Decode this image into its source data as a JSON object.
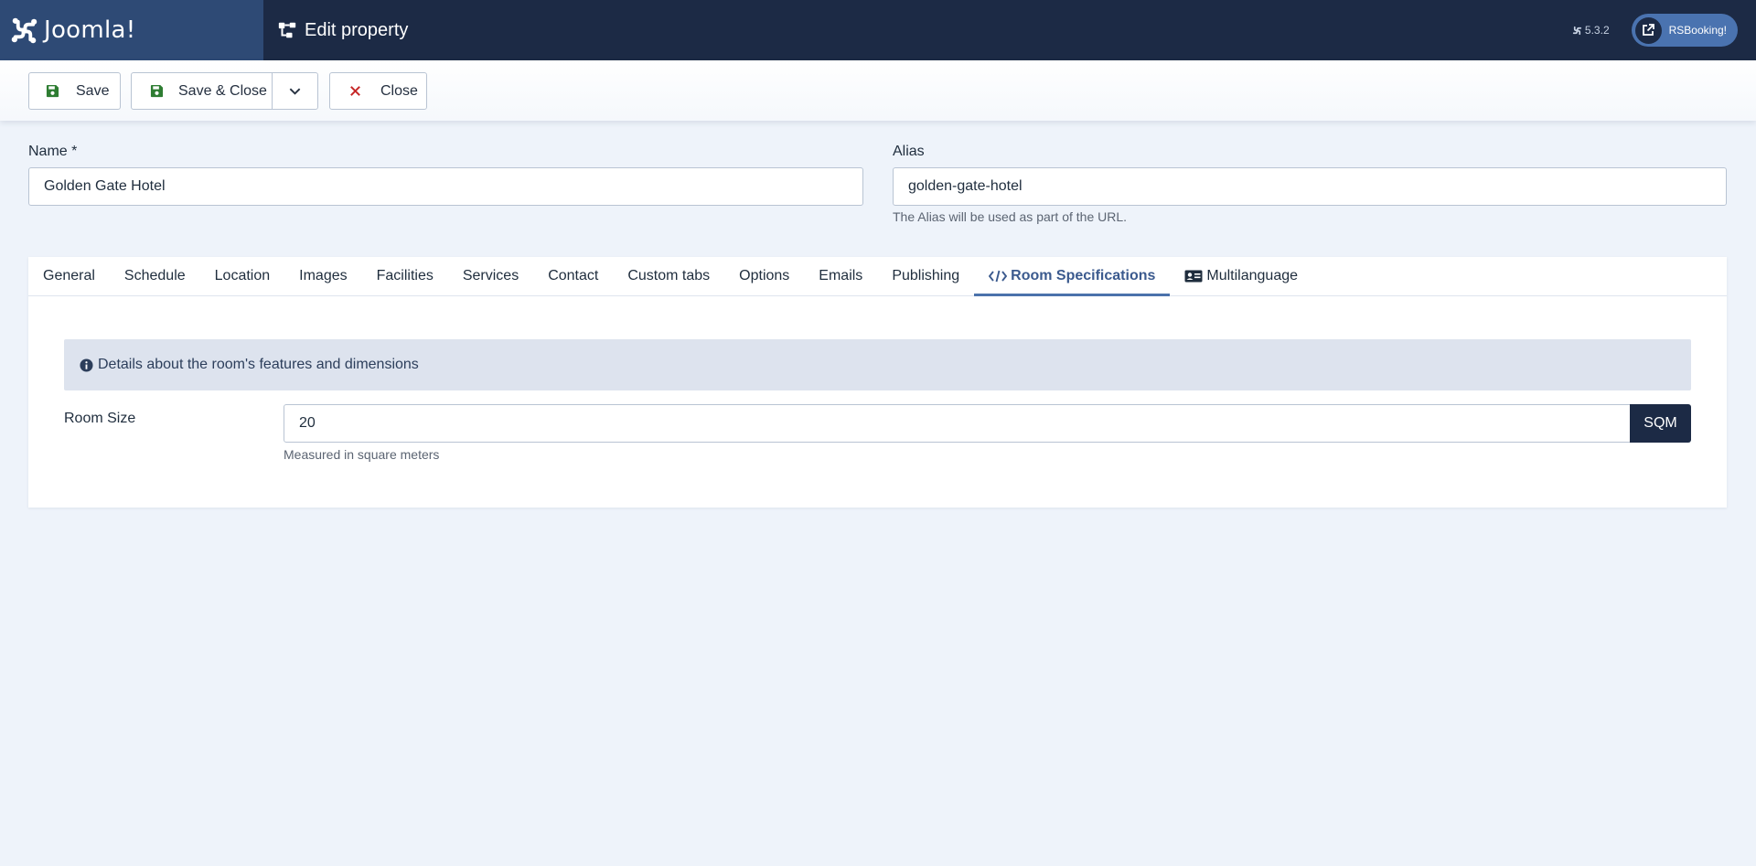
{
  "header": {
    "brand": "Joomla!",
    "title": "Edit property",
    "version": "5.3.2",
    "site_button": "RSBooking!"
  },
  "toolbar": {
    "save_label": "Save",
    "save_close_label": "Save & Close",
    "close_label": "Close"
  },
  "form": {
    "name_label": "Name *",
    "name_value": "Golden Gate Hotel",
    "alias_label": "Alias",
    "alias_value": "golden-gate-hotel",
    "alias_hint": "The Alias will be used as part of the URL."
  },
  "tabs": [
    {
      "label": "General"
    },
    {
      "label": "Schedule"
    },
    {
      "label": "Location"
    },
    {
      "label": "Images"
    },
    {
      "label": "Facilities"
    },
    {
      "label": "Services"
    },
    {
      "label": "Contact"
    },
    {
      "label": "Custom tabs"
    },
    {
      "label": "Options"
    },
    {
      "label": "Emails"
    },
    {
      "label": "Publishing"
    },
    {
      "label": "Room Specifications",
      "active": true,
      "icon": "code-icon"
    },
    {
      "label": "Multilanguage",
      "icon": "id-card-icon"
    }
  ],
  "room_specs": {
    "info_text": "Details about the room's features and dimensions",
    "room_size_label": "Room Size",
    "room_size_value": "20",
    "unit": "SQM",
    "room_size_hint": "Measured in square meters"
  },
  "colors": {
    "header_bg": "#1c2a45",
    "logo_bg": "#2e4a75",
    "active_tab": "#3b5a8e",
    "save_icon": "#2e7d32",
    "close_icon": "#c62828"
  }
}
